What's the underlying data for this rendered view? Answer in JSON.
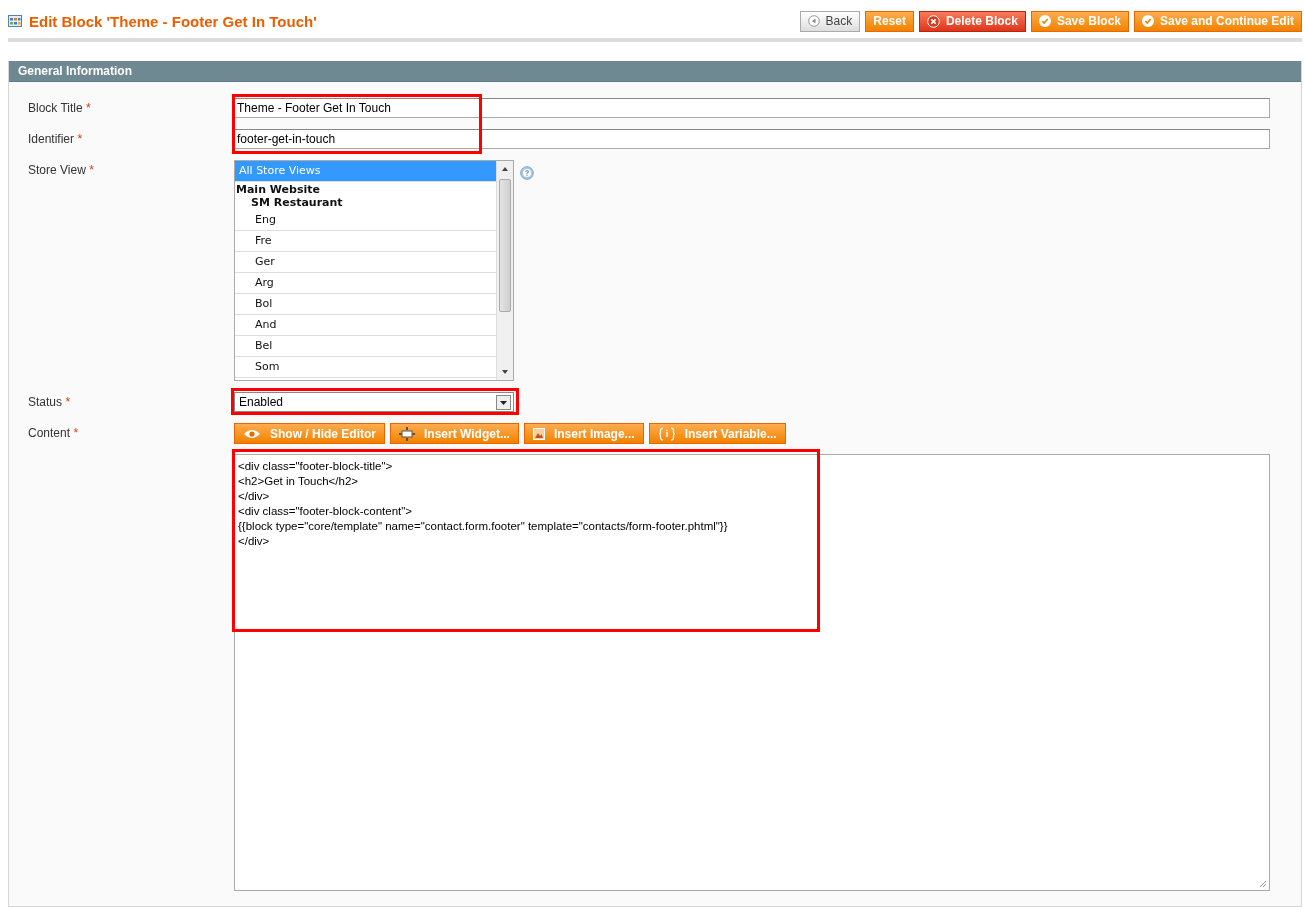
{
  "page_title": "Edit Block 'Theme - Footer Get In Touch'",
  "buttons": [
    {
      "label": "Back",
      "kind": "back"
    },
    {
      "label": "Reset",
      "kind": "plain"
    },
    {
      "label": "Delete Block",
      "kind": "delete"
    },
    {
      "label": "Save Block",
      "kind": "save"
    },
    {
      "label": "Save and Continue Edit",
      "kind": "save"
    }
  ],
  "section": {
    "title": "General Information"
  },
  "fields": {
    "block_title": {
      "label": "Block Title",
      "required_mark": "*",
      "value": "Theme - Footer Get In Touch"
    },
    "identifier": {
      "label": "Identifier",
      "required_mark": "*",
      "value": "footer-get-in-touch"
    },
    "store_view": {
      "label": "Store View",
      "required_mark": "*",
      "options": [
        {
          "label": "All Store Views",
          "kind": "option",
          "selected": true
        },
        {
          "label": "Main Website",
          "kind": "group",
          "selected": false
        },
        {
          "label": "SM Restaurant",
          "kind": "subgroup",
          "selected": false
        },
        {
          "label": "Eng",
          "kind": "store",
          "selected": false
        },
        {
          "label": "Fre",
          "kind": "store",
          "selected": false
        },
        {
          "label": "Ger",
          "kind": "store",
          "selected": false
        },
        {
          "label": "Arg",
          "kind": "store",
          "selected": false
        },
        {
          "label": "Bol",
          "kind": "store",
          "selected": false
        },
        {
          "label": "And",
          "kind": "store",
          "selected": false
        },
        {
          "label": "Bel",
          "kind": "store",
          "selected": false
        },
        {
          "label": "Som",
          "kind": "store",
          "selected": false
        }
      ]
    },
    "status": {
      "label": "Status",
      "required_mark": "*",
      "value": "Enabled"
    },
    "content": {
      "label": "Content",
      "required_mark": "*",
      "tools": [
        {
          "label": "Show / Hide Editor",
          "kind": "eye"
        },
        {
          "label": "Insert Widget...",
          "kind": "widget"
        },
        {
          "label": "Insert Image...",
          "kind": "image"
        },
        {
          "label": "Insert Variable...",
          "kind": "variable"
        }
      ],
      "lines": [
        "<div class=\"footer-block-title\">",
        "<h2>Get in Touch</h2>",
        "</div>",
        "<div class=\"footer-block-content\">",
        "{{block type=\"core/template\" name=\"contact.form.footer\" template=\"contacts/form-footer.phtml\"}}",
        "</div>"
      ]
    }
  }
}
